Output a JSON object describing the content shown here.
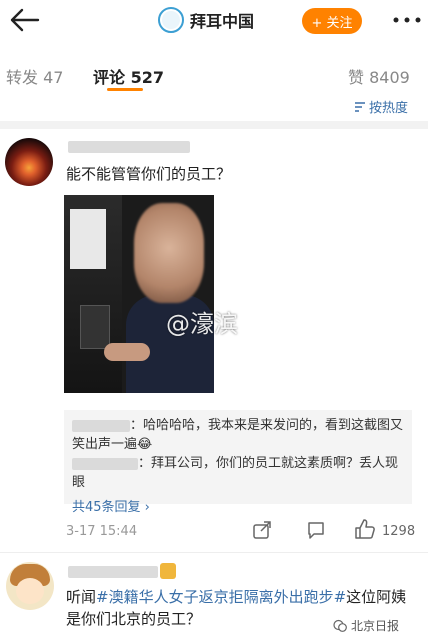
{
  "header": {
    "account_name": "拜耳中国",
    "follow_label": "+ 关注"
  },
  "tabs": [
    {
      "label": "转发 47"
    },
    {
      "label": "评论 527"
    },
    {
      "label": "赞 8409"
    }
  ],
  "sort_label": "按热度",
  "comment1": {
    "text": "能不能管管你们的员工？",
    "photo_watermark": "@濠滨",
    "replies": [
      {
        "text": "：哈哈哈哈，我本来是来发问的，看到这截图又笑出声一遍😂"
      },
      {
        "text": "：拜耳公司，你们的员工就这素质啊？丢人现眼"
      }
    ],
    "reply_count": "共45条回复 ›",
    "timestamp": "3-17 15:44",
    "likes": "1298"
  },
  "comment2": {
    "text_prefix": "听闻",
    "hashtag": "#澳籍华人女子返京拒隔离外出跑步#",
    "text_suffix": "这位阿姨是你们北京的员工？"
  },
  "source_mark": "北京日报",
  "colors": {
    "accent": "#ff8200",
    "link": "#3a6fa8"
  }
}
